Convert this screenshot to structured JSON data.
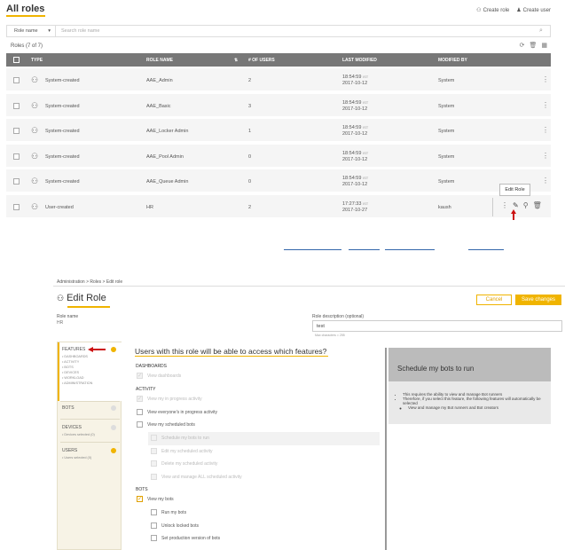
{
  "roles": {
    "title": "All roles",
    "create_role": "Create role",
    "create_user": "Create user",
    "filter": {
      "selected": "Role name",
      "placeholder": "Search role name"
    },
    "count": "Roles (7 of 7)",
    "columns": [
      "TYPE",
      "ROLE NAME",
      "# OF USERS",
      "LAST MODIFIED",
      "MODIFIED BY"
    ],
    "rows": [
      {
        "type": "System-created",
        "name": "AAE_Admin",
        "users": "2",
        "time": "18:54:59",
        "tz": "IST",
        "date": "2017-10-12",
        "by": "System"
      },
      {
        "type": "System-created",
        "name": "AAE_Basic",
        "users": "3",
        "time": "18:54:59",
        "tz": "IST",
        "date": "2017-10-12",
        "by": "System"
      },
      {
        "type": "System-created",
        "name": "AAE_Locker Admin",
        "users": "1",
        "time": "18:54:59",
        "tz": "IST",
        "date": "2017-10-12",
        "by": "System"
      },
      {
        "type": "System-created",
        "name": "AAE_Pool Admin",
        "users": "0",
        "time": "18:54:59",
        "tz": "IST",
        "date": "2017-10-12",
        "by": "System"
      },
      {
        "type": "System-created",
        "name": "AAE_Queue Admin",
        "users": "0",
        "time": "18:54:59",
        "tz": "IST",
        "date": "2017-10-12",
        "by": "System"
      },
      {
        "type": "User-created",
        "name": "HR",
        "users": "2",
        "time": "17:27:33",
        "tz": "IST",
        "date": "2017-10-27",
        "by": "kaush"
      }
    ],
    "tooltip": "Edit Role"
  },
  "edit": {
    "breadcrumb": "Administration  >  Roles  >  Edit role",
    "title": "Edit Role",
    "cancel": "Cancel",
    "save": "Save changes",
    "role_name_label": "Role name",
    "role_name_value": "HR",
    "desc_label": "Role description (optional)",
    "desc_value": "test",
    "desc_hint": "Max characters = 255",
    "sidebar": {
      "features": "FEATURES",
      "features_items": [
        "• DASHBOARDS",
        "• ACTIVITY",
        "• BOTS",
        "• DEVICES",
        "• WORKLOAD",
        "• ADMINISTRATION"
      ],
      "bots": "BOTS",
      "devices": "DEVICES",
      "devices_sub": "• Devices selected (0)",
      "users": "USERS",
      "users_sub": "• Users selected (0)"
    },
    "heading": "Users with this role will be able to access which features?",
    "dashboards": "DASHBOARDS",
    "view_dashboards": "View dashboards",
    "activity": "ACTIVITY",
    "act1": "View my in progress activity",
    "act2": "View everyone's in progress activity",
    "act3": "View my scheduled bots",
    "act3a": "Schedule my bots to run",
    "act3b": "Edit my scheduled activity",
    "act3c": "Delete my scheduled activity",
    "act3d": "View and manage ALL scheduled activity",
    "bots": "BOTS",
    "bot1": "View my bots",
    "bot2": "Run my bots",
    "bot3": "Unlock locked bots",
    "bot4": "Set production version of bots",
    "help_title": "Schedule my bots to run",
    "help_b1": "This requires the ability to view and manage Bot runners",
    "help_b2": "Therefore, if you select this feature, the following features will automatically be selected",
    "help_b3": "View and manage my Bot runners and Bot creators"
  },
  "colors": {
    "accent": "#f0b400",
    "arrow": "#cc1111",
    "header": "#777777"
  }
}
